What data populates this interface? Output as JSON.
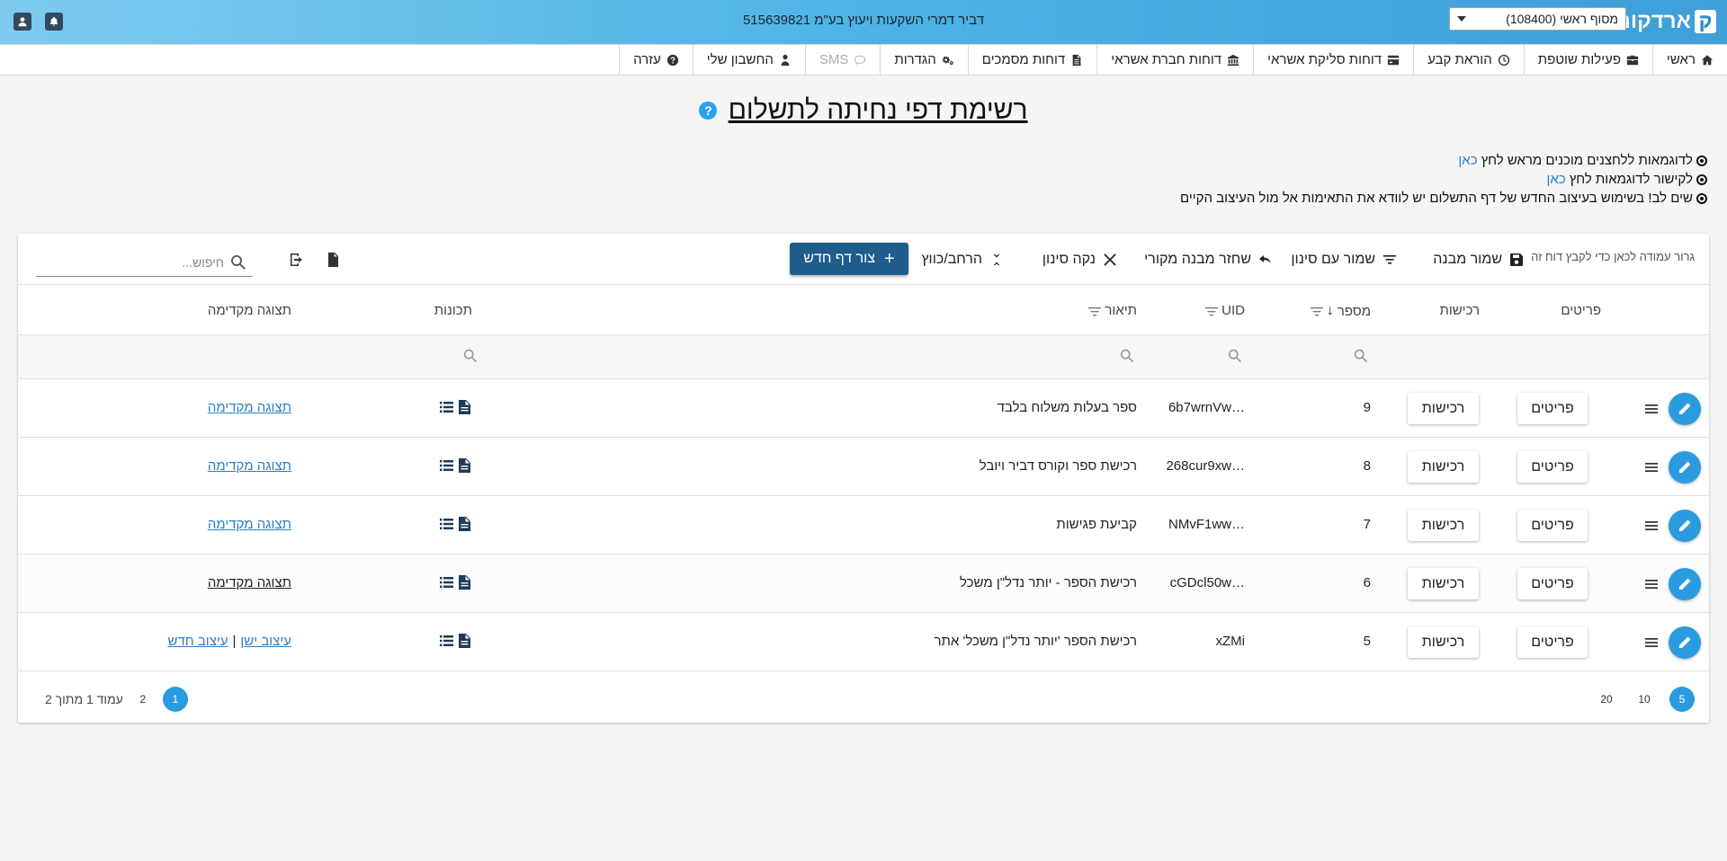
{
  "header": {
    "logo_text": "ארדקום",
    "logo_mark": "ק",
    "terminal_select": "מסוף ראשי (108400)",
    "company_title": "דביר דמרי השקעות ויעוץ בע\"מ 515639821"
  },
  "nav": [
    {
      "label": "ראשי",
      "icon": "home-icon"
    },
    {
      "label": "פעילות שוטפת",
      "icon": "briefcase-icon"
    },
    {
      "label": "הוראת קבע",
      "icon": "clock-icon"
    },
    {
      "label": "דוחות סליקת אשראי",
      "icon": "credit-card-icon"
    },
    {
      "label": "דוחות חברת אשראי",
      "icon": "bank-icon"
    },
    {
      "label": "דוחות מסמכים",
      "icon": "document-icon"
    },
    {
      "label": "הגדרות",
      "icon": "gears-icon"
    },
    {
      "label": "SMS",
      "icon": "chat-icon",
      "disabled": true
    },
    {
      "label": "החשבון שלי",
      "icon": "user-tie-icon"
    },
    {
      "label": "עזרה",
      "icon": "question-icon"
    }
  ],
  "page": {
    "title": "רשימת דפי נחיתה לתשלום",
    "help": "?"
  },
  "notes": [
    {
      "text": "לדוגמאות ללחצנים מוכנים מראש לחץ ",
      "link": "כאן"
    },
    {
      "text": "לקישור לדוגמאות לחץ ",
      "link": "כאן"
    },
    {
      "text": "שים לב! בשימוש בעיצוב החדש של דף התשלום יש לוודא את התאימות אל מול העיצוב הקיים",
      "link": ""
    }
  ],
  "toolbar": {
    "group_hint": "גרור עמודה לכאן כדי לקבץ דוח זה",
    "save_layout": "שמור מבנה",
    "save_filter": "שמור עם סינון",
    "restore_layout": "שחזר מבנה מקורי",
    "clear_filter": "נקה סינון",
    "expand_collapse": "הרחב/כווץ",
    "new_page": "צור דף חדש",
    "search_placeholder": "חיפוש..."
  },
  "columns": {
    "details": "פריטים",
    "purchases": "רכישות",
    "number": "מספר",
    "uid": "UID",
    "description": "תיאור",
    "features": "תכונות",
    "preview": "תצוגה מקדימה"
  },
  "row_buttons": {
    "details": "פריטים",
    "purchases": "רכישות"
  },
  "rows": [
    {
      "number": "9",
      "uid": "6b7wrnVw…",
      "description": "ספר בעלות משלוח בלבד",
      "preview": "תצוגה מקדימה"
    },
    {
      "number": "8",
      "uid": "268cur9xw…",
      "description": "רכישת ספר וקורס דביר ויובל",
      "preview": "תצוגה מקדימה"
    },
    {
      "number": "7",
      "uid": "NMvF1ww…",
      "description": "קביעת פגישות",
      "preview": "תצוגה מקדימה"
    },
    {
      "number": "6",
      "uid": "cGDcl50w…",
      "description": "רכישת הספר - יותר נדל\"ן משכל",
      "preview": "תצוגה מקדימה"
    },
    {
      "number": "5",
      "uid": "xZMi",
      "description": "רכישת הספר 'יותר נדל\"ן משכל' אתר",
      "old_design": "עיצוב ישן",
      "new_design": "עיצוב חדש",
      "separator": "|"
    }
  ],
  "pager": {
    "sizes": [
      "5",
      "10",
      "20"
    ],
    "active_size": "5",
    "pages": [
      "1",
      "2"
    ],
    "active_page": "1",
    "info": "עמוד 1 מתוך 2"
  },
  "colors": {
    "accent": "#2b9be0",
    "primary_button": "#1e5d8c"
  }
}
